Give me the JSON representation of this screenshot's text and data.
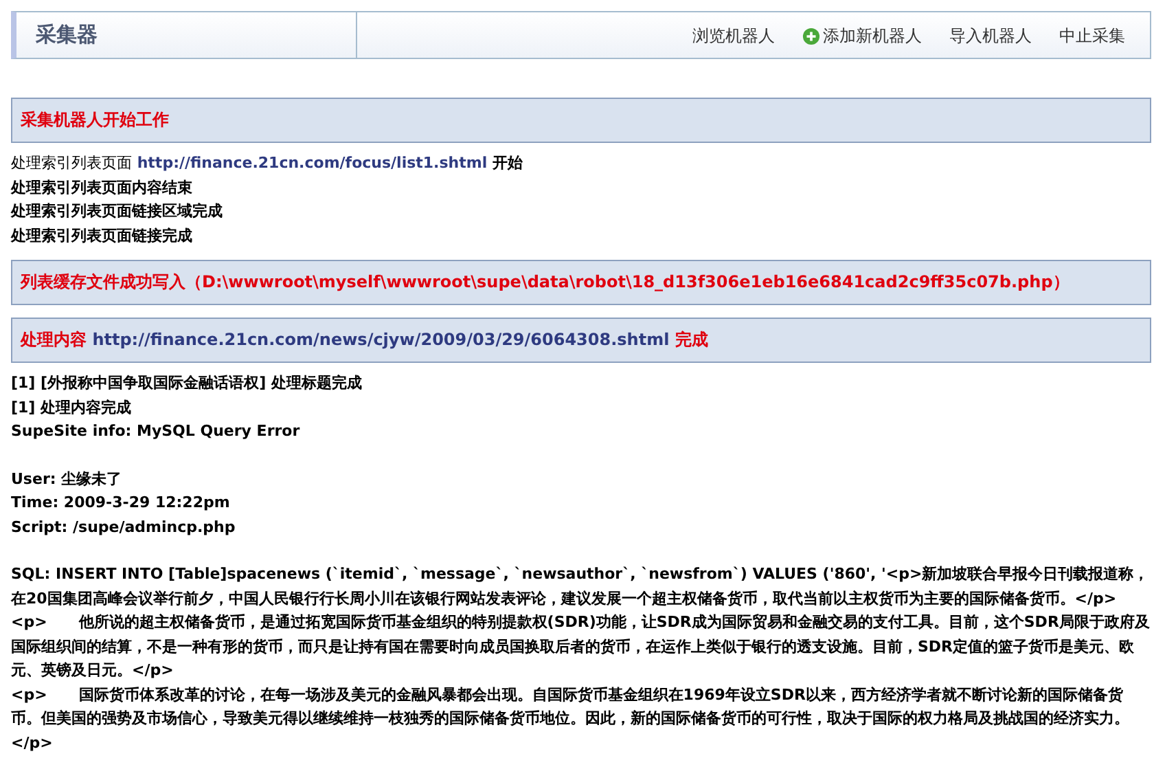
{
  "header": {
    "title": "采集器",
    "nav": [
      {
        "label": "浏览机器人",
        "icon": false
      },
      {
        "label": "添加新机器人",
        "icon": true
      },
      {
        "label": "导入机器人",
        "icon": false
      },
      {
        "label": "中止采集",
        "icon": false
      }
    ]
  },
  "start_banner": "采集机器人开始工作",
  "index_log": {
    "label": "处理索引列表页面",
    "url": "http://finance.21cn.com/focus/list1.shtml",
    "suffix": "开始",
    "lines": [
      "处理索引列表页面内容结束",
      "处理索引列表页面链接区域完成",
      "处理索引列表页面链接完成"
    ]
  },
  "cache_banner": "列表缓存文件成功写入（D:\\wwwroot\\myself\\wwwroot\\supe\\data\\robot\\18_d13f306e1eb16e6841cad2c9ff35c07b.php）",
  "content_banner": {
    "label": "处理内容",
    "url": "http://finance.21cn.com/news/cjyw/2009/03/29/6064308.shtml",
    "suffix": "完成"
  },
  "result_lines": [
    "[1] [外报称中国争取国际金融话语权] 处理标题完成",
    "[1] 处理内容完成",
    "SupeSite info: MySQL Query Error"
  ],
  "error_info": [
    "User: 尘缘未了",
    "Time: 2009-3-29 12:22pm",
    "Script: /supe/admincp.php"
  ],
  "sql": [
    "SQL: INSERT INTO [Table]spacenews (`itemid`, `message`, `newsauthor`, `newsfrom`) VALUES ('860', '<p>新加坡联合早报今日刊载报道称，在20国集团高峰会议举行前夕，中国人民银行行长周小川在该银行网站发表评论，建议发展一个超主权储备货币，取代当前以主权货币为主要的国际储备货币。</p>",
    "<p>      他所说的超主权储备货币，是通过拓宽国际货币基金组织的特别提款权(SDR)功能，让SDR成为国际贸易和金融交易的支付工具。目前，这个SDR局限于政府及国际组织间的结算，不是一种有形的货币，而只是让持有国在需要时向成员国换取后者的货币，在运作上类似于银行的透支设施。目前，SDR定值的篮子货币是美元、欧元、英镑及日元。</p>",
    "<p>      国际货币体系改革的讨论，在每一场涉及美元的金融风暴都会出现。自国际货币基金组织在1969年设立SDR以来，西方经济学者就不断讨论新的国际储备货币。但美国的强势及市场信心，导致美元得以继续维持一枝独秀的国际储备货币地位。因此，新的国际储备货币的可行性，取决于国际的权力格局及挑战国的经济实力。</p>"
  ]
}
